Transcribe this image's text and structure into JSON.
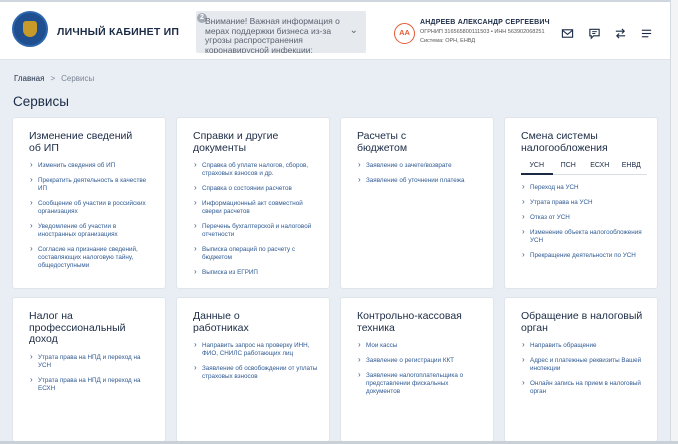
{
  "header": {
    "title": "ЛИЧНЫЙ КАБИНЕТ ИП",
    "notice_badge": "2",
    "notice_text": "Внимание! Важная информация о мерах поддержки бизнеса из-за угрозы распространения коронавирусной инфекции:",
    "user": {
      "initials": "АА",
      "name": "АНДРЕЕВ АЛЕКСАНДР СЕРГЕЕВИЧ",
      "ids": "ОГРНИП 316565800111503 • ИНН 563902068251",
      "system": "Система: ОРН, ЕНВД"
    },
    "icons": [
      "mail-icon",
      "chat-icon",
      "swap-icon",
      "menu-icon"
    ]
  },
  "breadcrumb": {
    "home": "Главная",
    "separator": ">",
    "current": "Сервисы"
  },
  "page_title": "Сервисы",
  "cards": {
    "change_info": {
      "title": "Изменение сведений об ИП",
      "links": [
        "Изменить сведения об ИП",
        "Прекратить деятельность в качестве ИП",
        "Сообщение об участии в российских организациях",
        "Уведомление об участии в иностранных организациях",
        "Согласие на признание сведений, составляющих налоговую тайну, общедоступными"
      ]
    },
    "references": {
      "title": "Справки и другие документы",
      "links": [
        "Справка об уплате налогов, сборов, страховых взносов и др.",
        "Справка о состоянии расчетов",
        "Информационный акт совместной сверки расчетов",
        "Перечень бухгалтерской и налоговой отчетности",
        "Выписка операций по расчету с бюджетом",
        "Выписка из ЕГРИП"
      ]
    },
    "budget": {
      "title": "Расчеты с бюджетом",
      "links": [
        "Заявление о зачете/возврате",
        "Заявление об уточнении платежа"
      ]
    },
    "tax_system": {
      "title": "Смена системы налогообложения",
      "tabs": [
        "УСН",
        "ПСН",
        "ЕСХН",
        "ЕНВД"
      ],
      "active_tab": "УСН",
      "links": [
        "Переход на УСН",
        "Утрата права на УСН",
        "Отказ от УСН",
        "Изменение объекта налогообложения УСН",
        "Прекращение деятельности по УСН"
      ]
    },
    "npd": {
      "title": "Налог на профессиональный доход",
      "links": [
        "Утрата права на НПД и переход на УСН",
        "Утрата права на НПД и переход на ЕСХН"
      ]
    },
    "employees": {
      "title": "Данные о работниках",
      "links": [
        "Направить запрос на проверку ИНН, ФИО, СНИЛС работающих лиц",
        "Заявление об освобождении от уплаты страховых взносов"
      ]
    },
    "kkt": {
      "title": "Контрольно-кассовая техника",
      "links": [
        "Мои кассы",
        "Заявление о регистрации ККТ",
        "Заявление налогоплательщика о представлении фискальных документов"
      ]
    },
    "appeal": {
      "title": "Обращение в налоговый орган",
      "links": [
        "Направить обращение",
        "Адрес и платежные реквизиты Вашей инспекции",
        "Онлайн запись на прием в налоговый орган"
      ]
    }
  }
}
